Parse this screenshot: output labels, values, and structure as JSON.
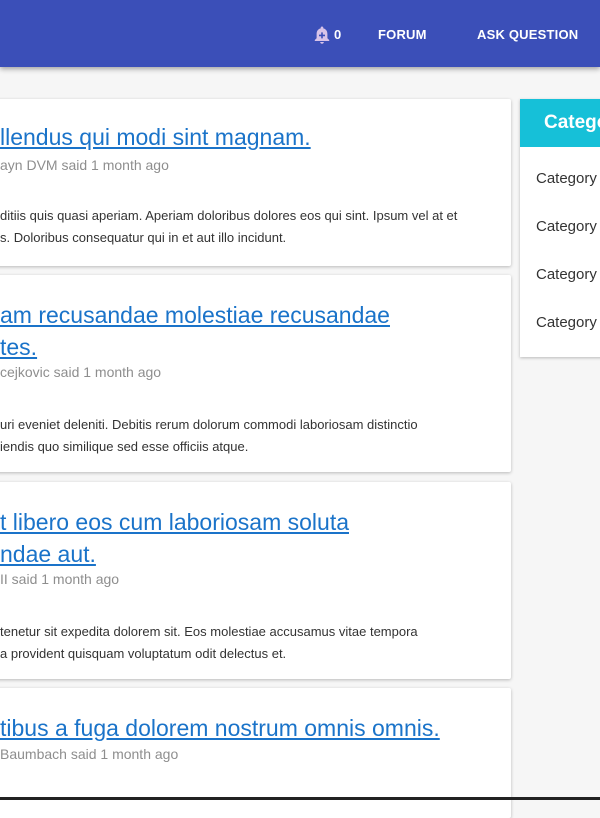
{
  "nav": {
    "notification_count": "0",
    "forum_label": "FORUM",
    "ask_label": "ASK QUESTION",
    "bell_icon": "bell-icon"
  },
  "posts": [
    {
      "title_lines": [
        "llendus qui modi sint magnam."
      ],
      "meta": "ayn DVM said 1 month ago",
      "body_lines": [
        "ditiis quis quasi aperiam. Aperiam doloribus dolores eos qui sint. Ipsum vel at et",
        "s. Doloribus consequatur qui in et aut illo incidunt."
      ]
    },
    {
      "title_lines": [
        "am recusandae molestiae recusandae",
        "tes."
      ],
      "meta": "cejkovic said 1 month ago",
      "body_lines": [
        "uri eveniet deleniti. Debitis rerum dolorum commodi laboriosam distinctio",
        "iendis quo similique sed esse officiis atque."
      ]
    },
    {
      "title_lines": [
        "t libero eos cum laboriosam soluta",
        "ndae aut."
      ],
      "meta": "II said 1 month ago",
      "body_lines": [
        "tenetur sit expedita dolorem sit. Eos molestiae accusamus vitae tempora",
        "a provident quisquam voluptatum odit delectus et."
      ]
    },
    {
      "title_lines": [
        "tibus a fuga dolorem nostrum omnis omnis."
      ],
      "meta": "Baumbach said 1 month ago",
      "body_lines": []
    }
  ],
  "sidebar": {
    "header": "Catego",
    "items": [
      "Category",
      "Category",
      "Category",
      "Category"
    ]
  },
  "colors": {
    "topbar": "#3b4fb8",
    "link": "#1a73c9",
    "sidebar_header": "#16c0d8"
  }
}
